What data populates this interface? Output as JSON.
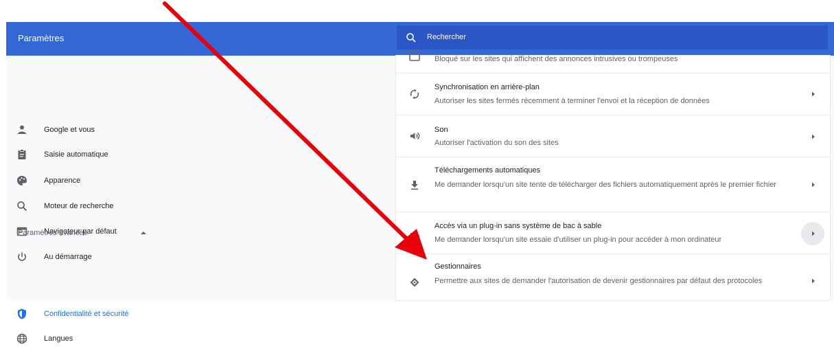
{
  "header": {
    "title": "Paramètres"
  },
  "search": {
    "placeholder": "Rechercher"
  },
  "sidebar": {
    "items": [
      {
        "label": "Google et vous",
        "icon": "person-icon"
      },
      {
        "label": "Saisie automatique",
        "icon": "clipboard-icon"
      },
      {
        "label": "Apparence",
        "icon": "palette-icon"
      },
      {
        "label": "Moteur de recherche",
        "icon": "search-icon"
      },
      {
        "label": "Navigateur par défaut",
        "icon": "browser-icon"
      },
      {
        "label": "Au démarrage",
        "icon": "power-icon"
      }
    ],
    "advanced_label": "Paramètres avancés",
    "advanced_items": [
      {
        "label": "Confidentialité et sécurité",
        "icon": "shield-icon",
        "active": true
      },
      {
        "label": "Langues",
        "icon": "globe-icon"
      }
    ],
    "active_color": "#1a73e8"
  },
  "content": {
    "rows": [
      {
        "title": "",
        "desc": "Bloqué sur les sites qui affichent des annonces intrusives ou trompeuses",
        "icon": "ads-icon"
      },
      {
        "title": "Synchronisation en arrière-plan",
        "desc": "Autoriser les sites fermés récemment à terminer l'envoi et la réception de données",
        "icon": "sync-icon"
      },
      {
        "title": "Son",
        "desc": "Autoriser l'activation du son des sites",
        "icon": "volume-icon"
      },
      {
        "title": "Téléchargements automatiques",
        "desc": "Me demander lorsqu'un site tente de télécharger des fichiers automatiquement après le premier fichier",
        "icon": "download-icon"
      },
      {
        "title": "Accès via un plug-in sans système de bac à sable",
        "desc": "Me demander lorsqu'un site essaie d'utiliser un plug-in pour accéder à mon ordinateur",
        "icon": "puzzle-icon"
      },
      {
        "title": "Gestionnaires",
        "desc": "Permettre aux sites de demander l'autorisation de devenir gestionnaires par défaut des protocoles",
        "icon": "handler-icon"
      }
    ]
  },
  "colors": {
    "header_bg": "#3367d6",
    "search_bg": "#2a56c6",
    "annotation_arrow": "#e8000b"
  }
}
